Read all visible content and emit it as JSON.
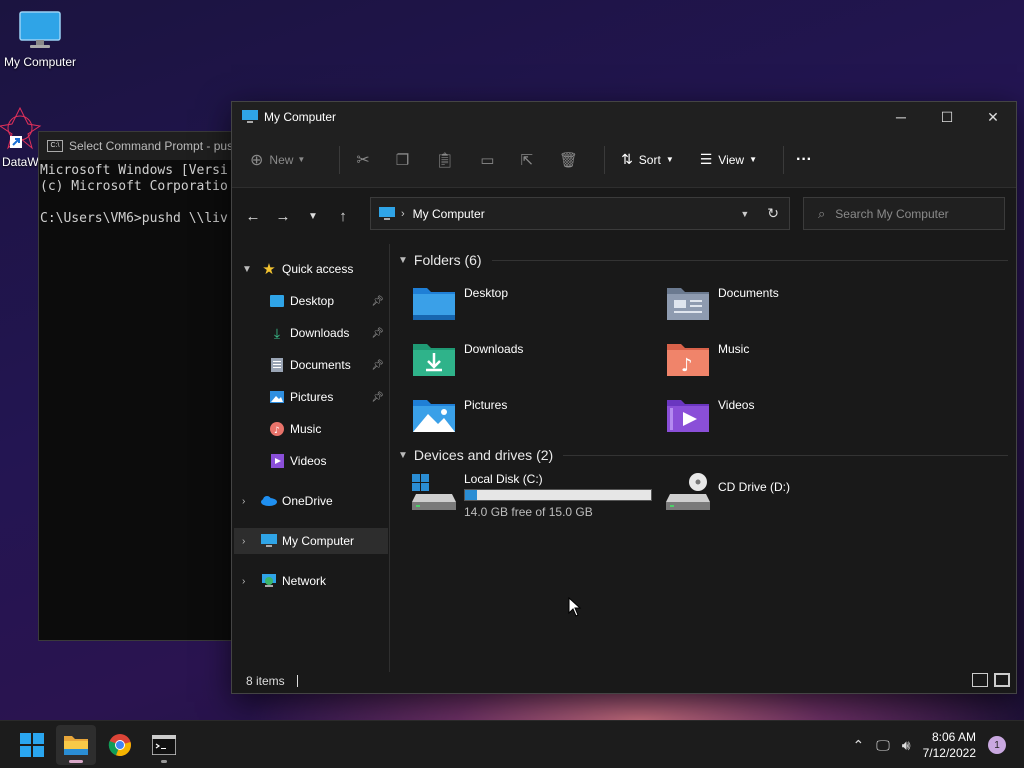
{
  "desktop": {
    "icons": [
      {
        "label": "My Computer",
        "icon": "monitor-icon"
      },
      {
        "label": "DataW",
        "icon": "datawrapper-icon"
      }
    ]
  },
  "cmd": {
    "title": "Select Command Prompt - pus",
    "lines": [
      "Microsoft Windows [Versi",
      "(c) Microsoft Corporatio",
      "",
      "C:\\Users\\VM6>pushd \\\\liv"
    ]
  },
  "explorer": {
    "title": "My Computer",
    "window_buttons": {
      "minimize": "─",
      "maximize": "☐",
      "close": "✕"
    },
    "commandbar": {
      "new_label": "New",
      "sort_label": "Sort",
      "view_label": "View",
      "more_label": "···"
    },
    "address": {
      "path": "My Computer"
    },
    "search": {
      "placeholder": "Search My Computer"
    },
    "sidebar": {
      "quick_access": "Quick access",
      "items": [
        {
          "label": "Desktop",
          "icon": "desktop-folder-icon",
          "pinned": true
        },
        {
          "label": "Downloads",
          "icon": "download-icon",
          "pinned": true
        },
        {
          "label": "Documents",
          "icon": "document-icon",
          "pinned": true
        },
        {
          "label": "Pictures",
          "icon": "pictures-icon",
          "pinned": true
        },
        {
          "label": "Music",
          "icon": "music-icon",
          "pinned": false
        },
        {
          "label": "Videos",
          "icon": "videos-icon",
          "pinned": false
        }
      ],
      "onedrive": "OneDrive",
      "mycomputer": "My Computer",
      "network": "Network"
    },
    "folders_header": "Folders (6)",
    "folders": [
      {
        "name": "Desktop",
        "icon": "desktop-folder-icon"
      },
      {
        "name": "Documents",
        "icon": "documents-folder-icon"
      },
      {
        "name": "Downloads",
        "icon": "downloads-folder-icon"
      },
      {
        "name": "Music",
        "icon": "music-folder-icon"
      },
      {
        "name": "Pictures",
        "icon": "pictures-folder-icon"
      },
      {
        "name": "Videos",
        "icon": "videos-folder-icon"
      }
    ],
    "drives_header": "Devices and drives (2)",
    "drives": {
      "local": {
        "name": "Local Disk (C:)",
        "free_text": "14.0 GB free of 15.0 GB",
        "used_fraction": 0.067
      },
      "cd": {
        "name": "CD Drive (D:)"
      }
    },
    "status": {
      "items": "8 items"
    }
  },
  "taskbar": {
    "time": "8:06 AM",
    "date": "7/12/2022",
    "notification_count": "1"
  },
  "colors": {
    "accent": "#2a8dd4",
    "folder_blue": "#3aa0e8",
    "folder_green": "#2fb38a"
  }
}
